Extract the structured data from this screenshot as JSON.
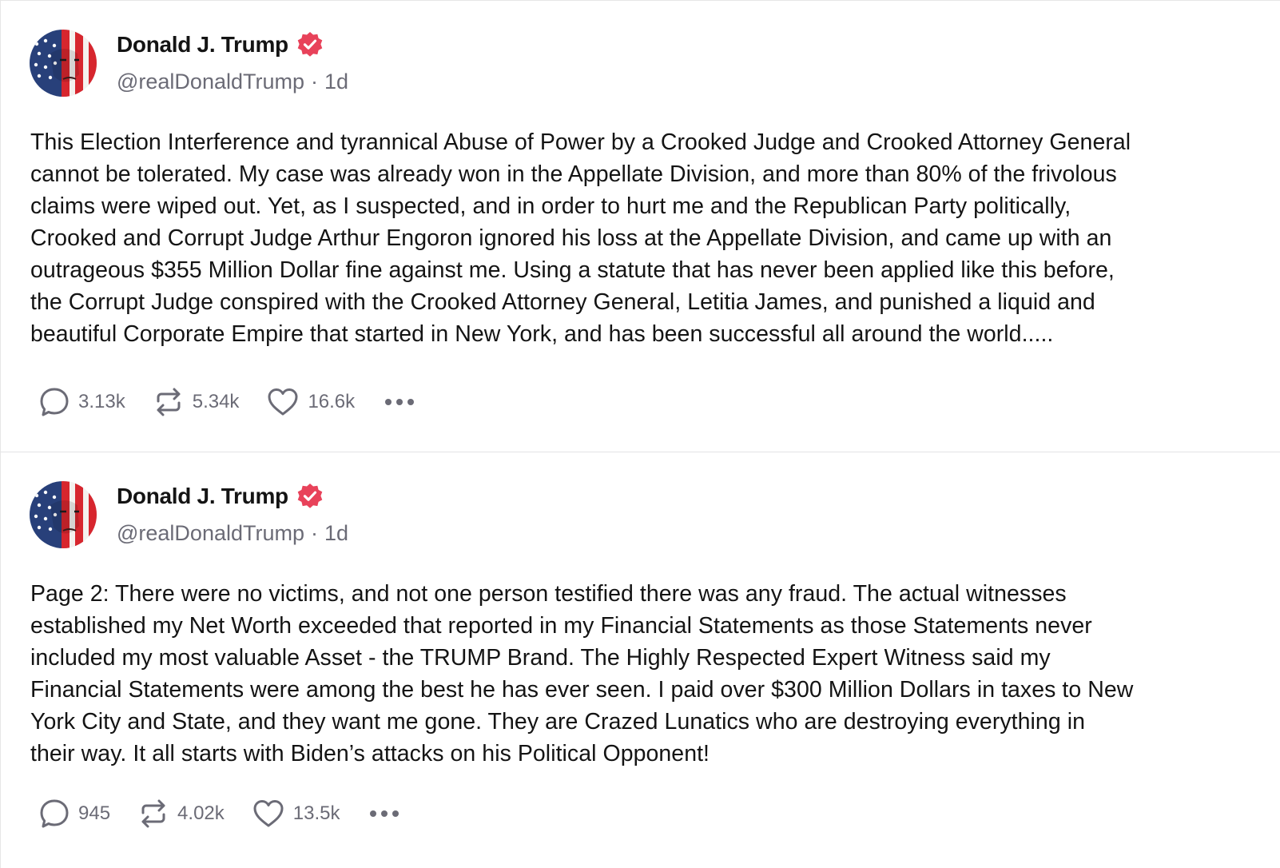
{
  "posts": [
    {
      "author": {
        "name": "Donald J. Trump",
        "handle": "@realDonaldTrump",
        "separator": "·",
        "time": "1d",
        "avatar_icon": "flag-face-avatar",
        "verified_icon": "verified-badge-icon"
      },
      "text_lines": [
        "This Election Interference and tyrannical Abuse of Power by a Crooked Judge and Crooked Attorney General",
        "cannot be tolerated. My case was already won in the Appellate Division, and more than 80% of the frivolous",
        "claims were wiped out. Yet, as I suspected, and in order to hurt me and the Republican Party politically,",
        "Crooked and Corrupt Judge Arthur Engoron ignored his loss at the Appellate Division, and came up with an",
        "outrageous $355 Million Dollar fine against me. Using a statute that has never been applied like this before,",
        "the Corrupt Judge conspired with the Crooked Attorney General, Letitia James, and punished a liquid and",
        "beautiful Corporate Empire that started in New York, and has been successful all around the world....."
      ],
      "actions": {
        "replies": "3.13k",
        "reposts": "5.34k",
        "likes": "16.6k"
      }
    },
    {
      "author": {
        "name": "Donald J. Trump",
        "handle": "@realDonaldTrump",
        "separator": "·",
        "time": "1d",
        "avatar_icon": "flag-face-avatar",
        "verified_icon": "verified-badge-icon"
      },
      "text_lines": [
        "Page 2: There were no victims, and not one person testified there was any fraud. The actual witnesses",
        "established my Net Worth exceeded that reported in my Financial Statements as those Statements never",
        "included my most valuable Asset - the TRUMP Brand. The Highly Respected Expert Witness said my",
        "Financial Statements were among the best he has ever seen. I paid over $300 Million Dollars in taxes to New",
        "York City and State, and they want me gone. They are Crazed Lunatics who are destroying everything in",
        "their way. It all starts with Biden’s attacks on his Political Opponent!"
      ],
      "actions": {
        "replies": "945",
        "reposts": "4.02k",
        "likes": "13.5k"
      }
    }
  ],
  "colors": {
    "verified": "#e8425a",
    "muted": "#6b6b76",
    "text": "#141414",
    "divider": "#e3e3e6"
  }
}
